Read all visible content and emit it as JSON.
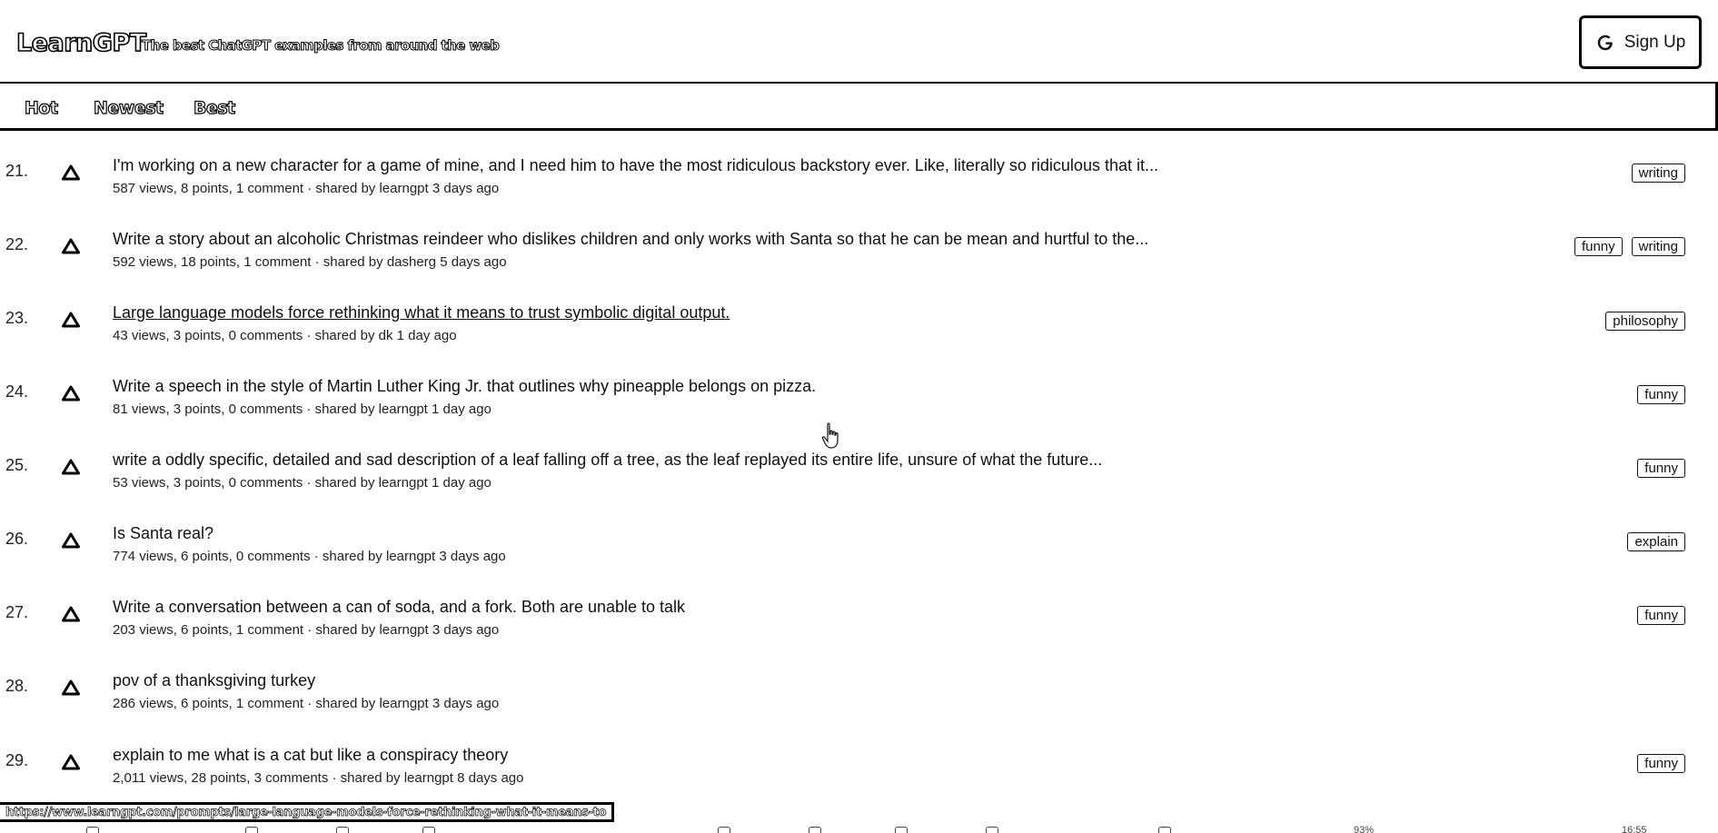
{
  "header": {
    "logo": "LearnGPT",
    "tagline": "The best ChatGPT examples from around the web",
    "signup_label": "Sign Up"
  },
  "tabs": [
    {
      "label": "Hot",
      "active": true
    },
    {
      "label": "Newest",
      "active": false
    },
    {
      "label": "Best",
      "active": false
    }
  ],
  "items": [
    {
      "rank": "21.",
      "title": "I'm working on a new character for a game of mine, and I need him to have the most ridiculous backstory ever. Like, literally so ridiculous that it...",
      "meta": "587 views, 8 points, 1 comment · shared by learngpt 3 days ago",
      "tags": [
        "writing"
      ]
    },
    {
      "rank": "22.",
      "title": "Write a story about an alcoholic Christmas reindeer who dislikes children and only works with Santa so that he can be mean and hurtful to the...",
      "meta": "592 views, 18 points, 1 comment · shared by dasherg 5 days ago",
      "tags": [
        "funny",
        "writing"
      ]
    },
    {
      "rank": "23.",
      "title": "Large language models force rethinking what it means to trust symbolic digital output.",
      "meta": "43 views, 3 points, 0 comments · shared by dk 1 day ago",
      "tags": [
        "philosophy"
      ],
      "hovered": true
    },
    {
      "rank": "24.",
      "title": "Write a speech in the style of Martin Luther King Jr. that outlines why pineapple belongs on pizza.",
      "meta": "81 views, 3 points, 0 comments · shared by learngpt 1 day ago",
      "tags": [
        "funny"
      ]
    },
    {
      "rank": "25.",
      "title": "write a oddly specific, detailed and sad description of a leaf falling off a tree, as the leaf replayed its entire life, unsure of what the future...",
      "meta": "53 views, 3 points, 0 comments · shared by learngpt 1 day ago",
      "tags": [
        "funny"
      ]
    },
    {
      "rank": "26.",
      "title": "Is Santa real?",
      "meta": "774 views, 6 points, 0 comments · shared by learngpt 3 days ago",
      "tags": [
        "explain"
      ]
    },
    {
      "rank": "27.",
      "title": "Write a conversation between a can of soda, and a fork. Both are unable to talk",
      "meta": "203 views, 6 points, 1 comment · shared by learngpt 3 days ago",
      "tags": [
        "funny"
      ]
    },
    {
      "rank": "28.",
      "title": "pov of a thanksgiving turkey",
      "meta": "286 views, 6 points, 1 comment · shared by learngpt 3 days ago",
      "tags": []
    },
    {
      "rank": "29.",
      "title": "explain to me what is a cat but like a conspiracy theory",
      "meta": "2,011 views, 28 points, 3 comments · shared by learngpt 8 days ago",
      "tags": [
        "funny"
      ]
    }
  ],
  "statusbar": {
    "url": "https://www.learngpt.com/prompts/large-language-models-force-rethinking-what-it-means-to"
  },
  "taskbar": {
    "battery": "93%",
    "clock": "16:55"
  },
  "icons": {
    "google": "google-g-icon",
    "vote": "upvote-triangle-icon",
    "cursor": "hand-pointer-icon"
  }
}
